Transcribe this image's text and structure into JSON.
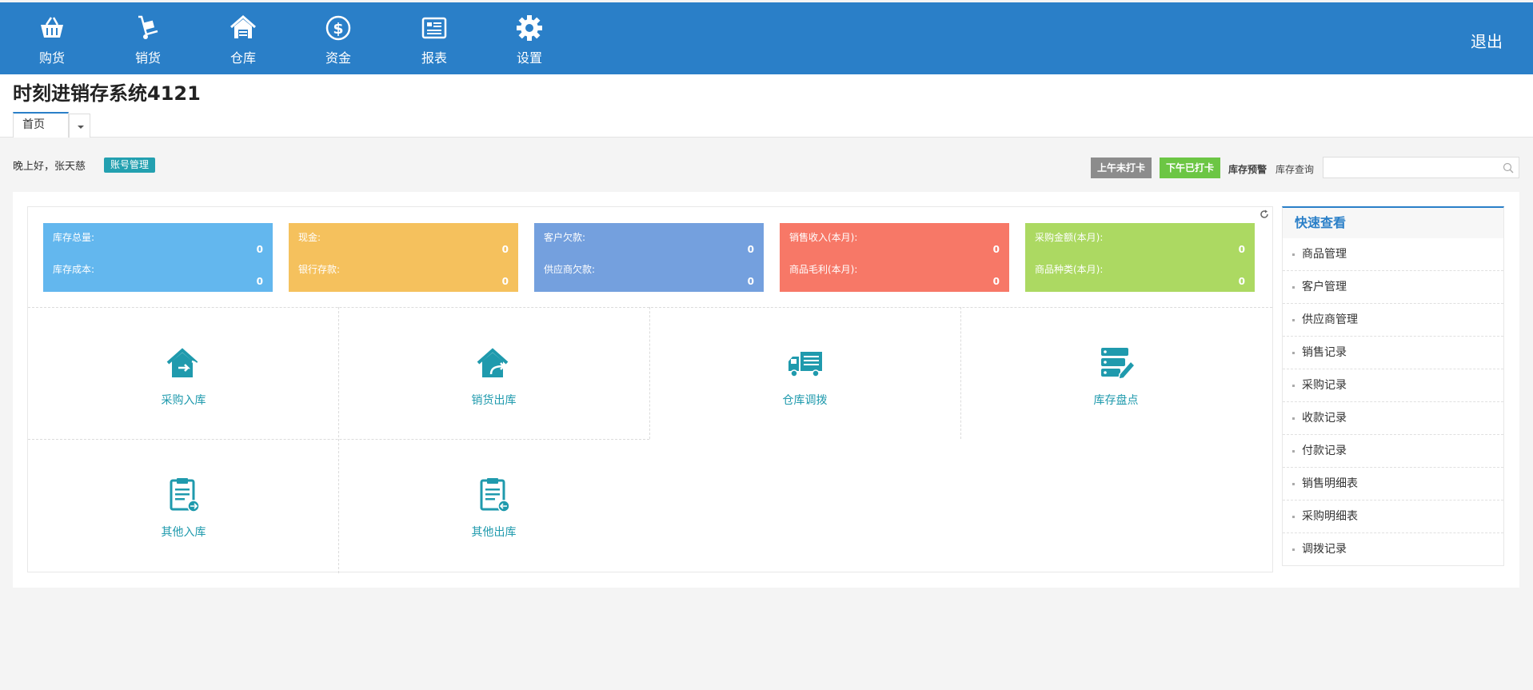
{
  "nav": {
    "items": [
      {
        "label": "购货",
        "icon": "basket-icon"
      },
      {
        "label": "销货",
        "icon": "handtruck-icon"
      },
      {
        "label": "仓库",
        "icon": "warehouse-icon"
      },
      {
        "label": "资金",
        "icon": "dollar-icon"
      },
      {
        "label": "报表",
        "icon": "report-icon"
      },
      {
        "label": "设置",
        "icon": "gear-icon"
      }
    ],
    "logout": "退出"
  },
  "header": {
    "title": "时刻进销存系统4121",
    "tab_home": "首页"
  },
  "toolbar": {
    "greeting": "晚上好，张天慈",
    "account_button": "账号管理",
    "punch_am": "上午未打卡",
    "punch_pm": "下午已打卡",
    "stock_warning": "库存预警",
    "stock_query_label": "库存查询",
    "search_value": ""
  },
  "stats": [
    {
      "color": "#63b7ee",
      "row1_label": "库存总量:",
      "row1_value": "0",
      "row2_label": "库存成本:",
      "row2_value": "0"
    },
    {
      "color": "#f5c15d",
      "row1_label": "现金:",
      "row1_value": "0",
      "row2_label": "银行存款:",
      "row2_value": "0"
    },
    {
      "color": "#74a0de",
      "row1_label": "客户欠款:",
      "row1_value": "0",
      "row2_label": "供应商欠款:",
      "row2_value": "0"
    },
    {
      "color": "#f77867",
      "row1_label": "销售收入(本月):",
      "row1_value": "0",
      "row2_label": "商品毛利(本月):",
      "row2_value": "0"
    },
    {
      "color": "#acd962",
      "row1_label": "采购金额(本月):",
      "row1_value": "0",
      "row2_label": "商品种类(本月):",
      "row2_value": "0"
    }
  ],
  "actions": [
    {
      "label": "采购入库",
      "icon": "purchase-in-icon"
    },
    {
      "label": "销货出库",
      "icon": "sales-out-icon"
    },
    {
      "label": "仓库调拨",
      "icon": "truck-icon"
    },
    {
      "label": "库存盘点",
      "icon": "inventory-check-icon"
    },
    {
      "label": "其他入库",
      "icon": "other-in-icon"
    },
    {
      "label": "其他出库",
      "icon": "other-out-icon"
    }
  ],
  "quick": {
    "title": "快速查看",
    "items": [
      "商品管理",
      "客户管理",
      "供应商管理",
      "销售记录",
      "采购记录",
      "收款记录",
      "付款记录",
      "销售明细表",
      "采购明细表",
      "调拨记录"
    ]
  },
  "colors": {
    "nav_bg": "#2a7fc8",
    "accent_teal": "#1f9aad"
  }
}
